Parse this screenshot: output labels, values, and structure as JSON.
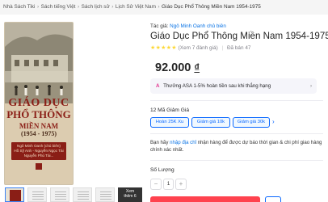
{
  "breadcrumb": [
    {
      "label": "Nhà Sách Tiki"
    },
    {
      "label": "Sách tiếng Việt"
    },
    {
      "label": "Sách lịch sử"
    },
    {
      "label": "Lịch Sử Việt Nam"
    },
    {
      "label": "Giáo Dục Phổ Thông Miền Nam 1954-1975"
    }
  ],
  "breadcrumb_separator": "›",
  "cover": {
    "title_line1": "GIÁO DỤC",
    "title_line2": "PHỔ THÔNG",
    "title_line3": "MIỀN NAM",
    "title_line4": "(1954 - 1975)",
    "authors": [
      "Ngô Minh Oanh (chủ biên)",
      "Hồ Sỹ Anh - Nguyễn Ngọc Tài",
      "Nguyễn Phú Tài..."
    ]
  },
  "thumbnails": {
    "more_label_line1": "Xem",
    "more_label_line2": "thêm 6"
  },
  "author": {
    "prefix": "Tác giả:",
    "name": "Ngô Minh Oanh chủ biên"
  },
  "title": "Giáo Dục Phổ Thông Miền Nam 1954-1975",
  "rating": {
    "stars": 5,
    "stars_text": "★★★★★",
    "reviews": "(Xem 7 đánh giá)",
    "sold": "Đã bán 47"
  },
  "price": {
    "amount": "92.000",
    "currency": "₫"
  },
  "promo": {
    "icon": "sparkle-icon",
    "text": "Thưởng ASA 1-5% hoàn tiền sau khi thắng hạng",
    "chevron": "›"
  },
  "coupons": {
    "title": "12 Mã Giảm Giá",
    "items": [
      {
        "label": "Hoàn 25K Xu"
      },
      {
        "label": "Giảm giá 10k"
      },
      {
        "label": "Giảm giá 30k"
      }
    ],
    "next": "›"
  },
  "shipping": {
    "prefix": "Bạn hãy",
    "link": "nhập địa chỉ",
    "text": "nhận hàng để được dự báo thời gian & chi phí giao hàng chính xác nhất."
  },
  "quantity": {
    "label": "Số Lượng",
    "minus": "−",
    "value": "1",
    "plus": "+"
  },
  "colors": {
    "accent_blue": "#0a68ff",
    "buy_red": "#ff424e",
    "star_yellow": "#fdd836",
    "cover_red": "#8a1e16"
  }
}
